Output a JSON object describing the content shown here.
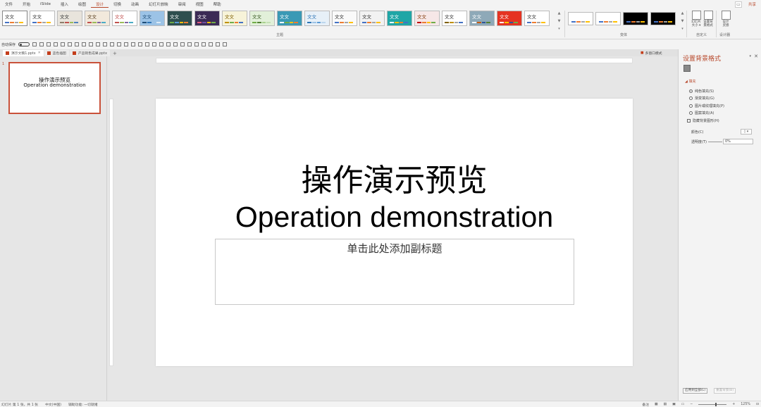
{
  "menubar": {
    "items": [
      "文件",
      "开始",
      "iSlide",
      "插入",
      "绘图",
      "设计",
      "切换",
      "动画",
      "幻灯片放映",
      "审阅",
      "视图",
      "帮助"
    ],
    "active_index": 5,
    "share_label": "共享"
  },
  "ribbon": {
    "theme_label": "文文",
    "themes_group_label": "主题",
    "variants_group_label": "变体",
    "customize_group_label": "自定义",
    "designer_group_label": "设计器",
    "slide_size_label": "幻灯片\n大小 ▾",
    "format_bg_label": "设置背\n景格式",
    "design_ideas_label": "设计\n灵感"
  },
  "qat": {
    "autosave_label": "自动保存"
  },
  "tabs": [
    {
      "label": "演示文稿1.pptx",
      "active": true
    },
    {
      "label": "蓝色插图",
      "active": false
    },
    {
      "label": "产品销售成果.pptx",
      "active": false
    }
  ],
  "thumbnail": {
    "number": "1",
    "title": "操作演示预览",
    "subtitle": "Operation demonstration"
  },
  "slide": {
    "title_cn": "操作演示预览",
    "title_en": "Operation demonstration",
    "subtitle_placeholder": "单击此处添加副标题"
  },
  "format_panel": {
    "multi_window_label": "多窗口模式",
    "title": "设置背景格式",
    "section": "填充",
    "options": [
      {
        "label": "纯色填充(S)",
        "type": "radio",
        "selected": true
      },
      {
        "label": "渐变填充(G)",
        "type": "radio",
        "selected": false
      },
      {
        "label": "图片或纹理填充(P)",
        "type": "radio",
        "selected": false
      },
      {
        "label": "图案填充(A)",
        "type": "radio",
        "selected": false
      },
      {
        "label": "隐藏背景图形(H)",
        "type": "checkbox",
        "selected": false
      }
    ],
    "color_label": "颜色(C)",
    "transparency_label": "透明度(T)",
    "transparency_value": "0%",
    "apply_all_label": "应用到全部(L)",
    "reset_label": "重置背景(B)"
  },
  "statusbar": {
    "slide_info": "幻灯片 第 1 张，共 1 张",
    "language": "中文(中国)",
    "accessibility": "辅助功能: 一切就绪",
    "notes_label": "备注",
    "zoom": "125%"
  },
  "colors": {
    "accent": "#b7472a",
    "thumb_border": "#c9513a"
  }
}
